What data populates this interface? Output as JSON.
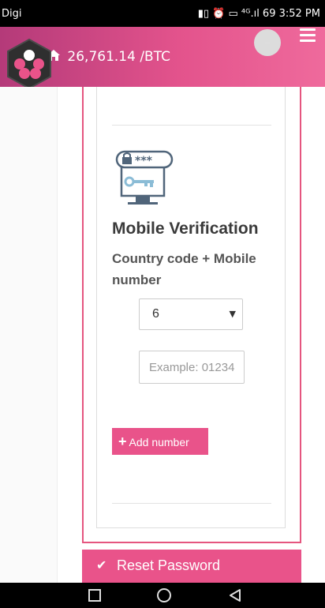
{
  "status_bar": {
    "carrier": "Digi",
    "icons_text": "▮▯ ⏰ ▭ ⁴ᴳ.ıl 69 3:52 PM"
  },
  "header": {
    "price": "26,761.14 /BTC",
    "home_icon": "home-icon",
    "menu_icon": "menu-icon",
    "avatar_text": "…"
  },
  "verification": {
    "title": "Mobile Verification",
    "subtitle": "Country code + Mobile number",
    "country_code": "6",
    "phone_placeholder": "Example: 01234",
    "add_button_label": "Add number"
  },
  "footer": {
    "reset_label": "Reset Password"
  },
  "colors": {
    "accent": "#e9538a",
    "header_start": "#b43a79",
    "header_end": "#ef6a9c"
  }
}
